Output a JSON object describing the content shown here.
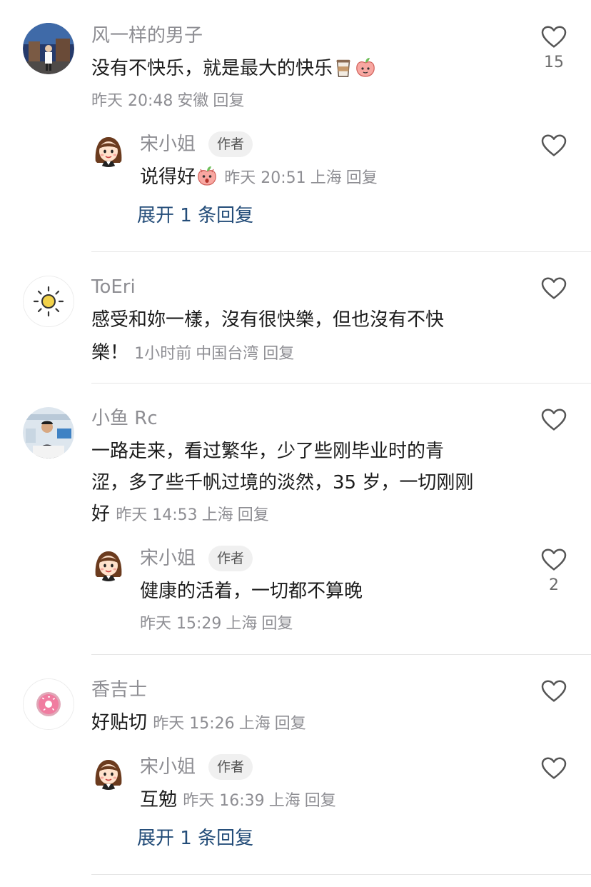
{
  "comments": [
    {
      "username": "风一样的男子",
      "text": "没有不快乐，就是最大的快乐",
      "time": "昨天 20:48",
      "location": "安徽",
      "reply_label": "回复",
      "likes": "15",
      "emojis": [
        "coffee-cup-emoji",
        "peach-emoji"
      ],
      "replies": [
        {
          "username": "宋小姐",
          "badge": "作者",
          "text": "说得好",
          "time": "昨天 20:51",
          "location": "上海",
          "reply_label": "回复",
          "emojis": [
            "surprised-peach-emoji"
          ]
        }
      ],
      "expand_label": "展开 1 条回复"
    },
    {
      "username": "ToEri",
      "text_line1": "感受和妳一樣，沒有很快樂，但也沒有不快",
      "text_line2": "樂！",
      "time": "1小时前",
      "location": "中国台湾",
      "reply_label": "回复"
    },
    {
      "username": "小鱼 Rc",
      "text_line1": "一路走来，看过繁华，少了些刚毕业时的青",
      "text_line2": "涩，多了些千帆过境的淡然，35 岁，一切刚刚",
      "text_line3": "好",
      "time": "昨天 14:53",
      "location": "上海",
      "reply_label": "回复",
      "replies": [
        {
          "username": "宋小姐",
          "badge": "作者",
          "text": "健康的活着，一切都不算晚",
          "time": "昨天 15:29",
          "location": "上海",
          "reply_label": "回复",
          "likes": "2"
        }
      ]
    },
    {
      "username": "香吉士",
      "text": "好贴切",
      "time": "昨天 15:26",
      "location": "上海",
      "reply_label": "回复",
      "replies": [
        {
          "username": "宋小姐",
          "badge": "作者",
          "text": "互勉",
          "time": "昨天 16:39",
          "location": "上海",
          "reply_label": "回复"
        }
      ],
      "expand_label": "展开 1 条回复"
    }
  ],
  "colors": {
    "username": "#8e8e93",
    "meta": "#8e8e93",
    "expand_link": "#244d79",
    "badge_bg": "#f0f0f0",
    "divider": "#e6e6e6"
  }
}
